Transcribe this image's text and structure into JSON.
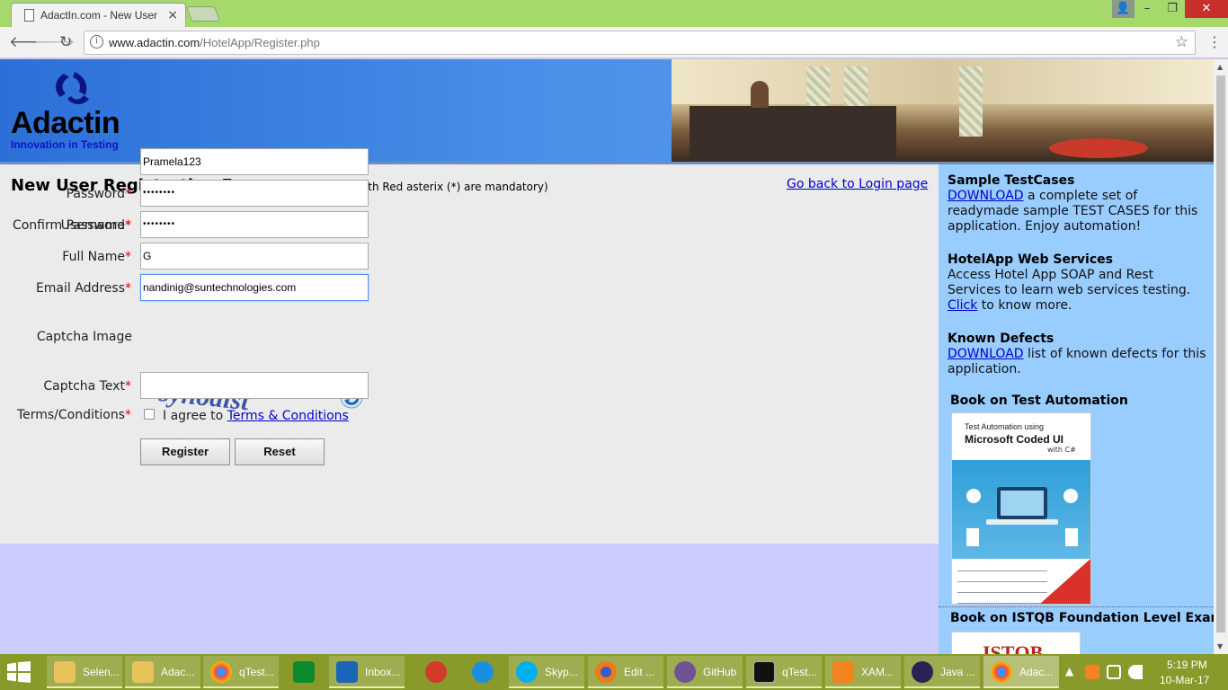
{
  "browser": {
    "tab_title": "AdactIn.com - New User",
    "tab_close": "×",
    "window_min": "–",
    "window_max": "❐",
    "window_close": "✕",
    "url_host": "www.adactin.com",
    "url_path": "/HotelApp/Register.php"
  },
  "header": {
    "logo_text": "Adactin",
    "logo_tagline": "Innovation in Testing"
  },
  "form": {
    "title": "New User Registration Form",
    "note": "(Fields marked with Red asterix (*) are mandatory)",
    "back_link": "Go back to Login page",
    "required_mark": "*",
    "username_label": "Username",
    "username_value": "Pramela123",
    "password_label": "Password",
    "password_value": "••••••••",
    "confirm_password_label": "Confirm Password",
    "confirm_password_value": "••••••••",
    "full_name_label": "Full Name",
    "full_name_value": "G",
    "email_label": "Email Address",
    "email_value": "nandinig@suntechnologies.com",
    "captcha_image_label": "Captcha Image",
    "captcha_word": "synodist",
    "captcha_text_label": "Captcha Text",
    "captcha_text_value": "",
    "terms_label": "Terms/Conditions",
    "agree_prefix": "I agree to ",
    "terms_link": "Terms & Conditions",
    "terms_checked": false,
    "register_button": "Register",
    "reset_button": "Reset"
  },
  "sidebar": {
    "testcases_heading": "Sample TestCases",
    "testcases_link": "DOWNLOAD",
    "testcases_text": " a complete set of readymade sample TEST CASES for this application. Enjoy automation!",
    "webservices_heading": "HotelApp Web Services",
    "webservices_text": "Access Hotel App SOAP and Rest Services to learn web services testing. ",
    "webservices_link": "Click",
    "webservices_text2": " to know more.",
    "defects_heading": "Known Defects",
    "defects_link": "DOWNLOAD",
    "defects_text": " list of known defects for this application.",
    "book1_heading": "Book on Test Automation",
    "book1_cover_line1": "Test Automation using",
    "book1_cover_line2": "Microsoft Coded UI",
    "book1_cover_line3": "with C#",
    "book2_heading": "Book on ISTQB Foundation Level Exam",
    "book2_cover_text": "ISTQB"
  },
  "taskbar": {
    "items": [
      {
        "label": "Selen..."
      },
      {
        "label": "Adac..."
      },
      {
        "label": "qTest..."
      },
      {
        "label": ""
      },
      {
        "label": "Inbox..."
      },
      {
        "label": ""
      },
      {
        "label": ""
      },
      {
        "label": "Skyp..."
      },
      {
        "label": "Edit ..."
      },
      {
        "label": "GitHub"
      },
      {
        "label": "qTest..."
      },
      {
        "label": "XAM..."
      },
      {
        "label": "Java ..."
      },
      {
        "label": "Adac..."
      }
    ],
    "tray_arrow": "▲",
    "time": "5:19 PM",
    "date": "10-Mar-17"
  },
  "colors": {
    "accent_link": "#0000cc",
    "required": "#dd0000",
    "sidebar_bg": "#99ccff",
    "page_bg": "#ccccff",
    "taskbar_bg": "#8a9a2a",
    "tabbar_bg": "#a6d96b"
  }
}
